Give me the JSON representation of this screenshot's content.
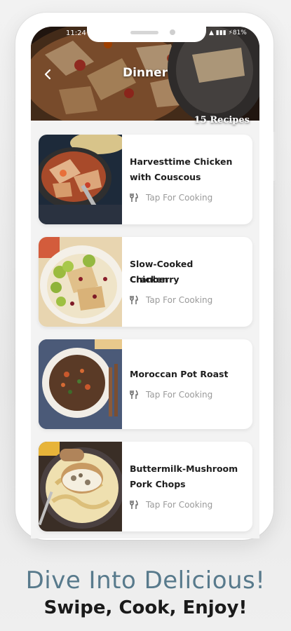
{
  "status_bar": {
    "time": "11:24",
    "indicators": "▲ ▮▮▮ ⚡81%"
  },
  "header": {
    "title": "Dinner",
    "recipe_count": "15 Recipes",
    "back_icon": "chevron-left-icon"
  },
  "recipes": [
    {
      "title_line1": "Harvesttime Chicken",
      "title_line2": "with Couscous",
      "cta": "Tap For Cooking"
    },
    {
      "title_line1": "Slow-Cooked Cranberry",
      "title_line2": "Chicken",
      "cta": "Tap For Cooking"
    },
    {
      "title_line1": "Moroccan Pot Roast",
      "title_line2": "",
      "cta": "Tap For Cooking"
    },
    {
      "title_line1": "Buttermilk-Mushroom",
      "title_line2": "Pork Chops",
      "cta": "Tap For Cooking"
    }
  ],
  "promo": {
    "tagline": "Dive Into Delicious!",
    "subline": "Swipe, Cook, Enjoy!"
  },
  "colors": {
    "tagline": "#587a8c",
    "card_bg": "#ffffff",
    "cta_text": "#9a9a9a"
  }
}
